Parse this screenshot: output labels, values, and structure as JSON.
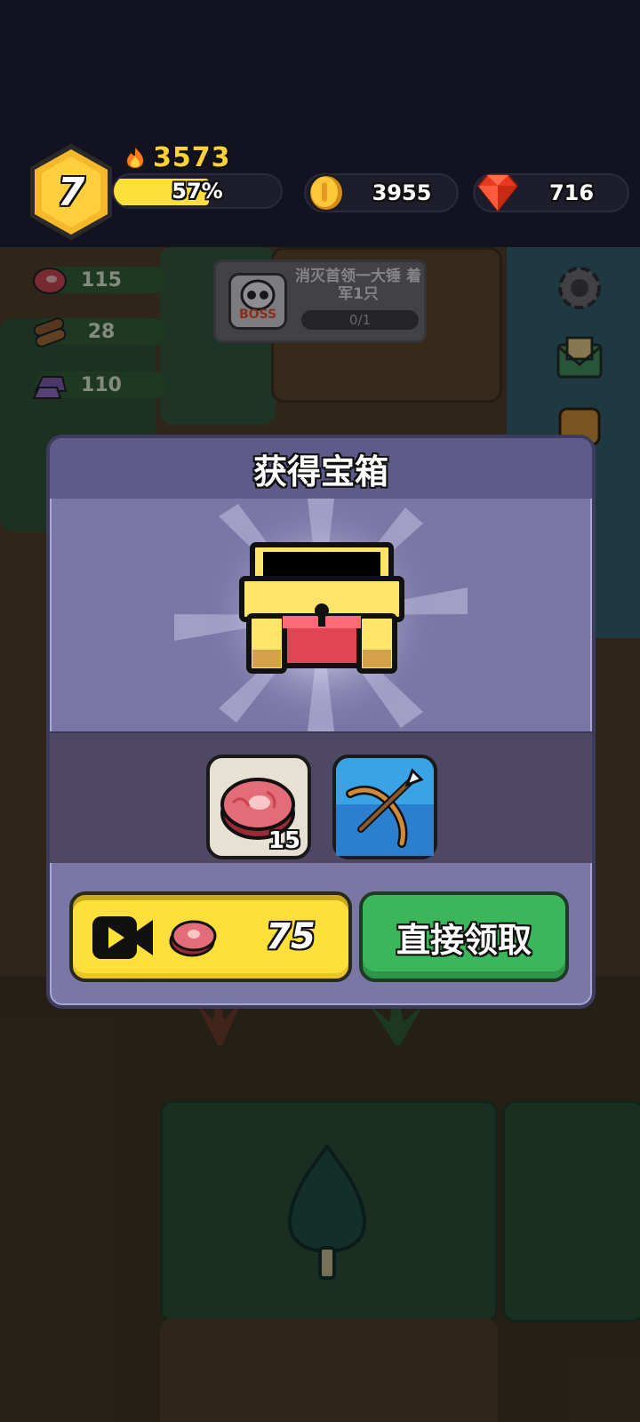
{
  "hud": {
    "level": "7",
    "power": "3573",
    "exp_percent_label": "57%",
    "exp_fraction": 0.57,
    "coins": "3955",
    "gems": "716"
  },
  "side_resources": [
    {
      "name": "meat",
      "value": "115"
    },
    {
      "name": "wood",
      "value": "28"
    },
    {
      "name": "ore",
      "value": "110"
    }
  ],
  "boss_task": {
    "badge": "BOSS",
    "text": "消灭首领一大锤 着军1只",
    "progress": "0/1"
  },
  "modal": {
    "title": "获得宝箱",
    "rewards": [
      {
        "icon": "meat-icon",
        "count": "15"
      },
      {
        "icon": "crossbow-icon",
        "count": ""
      }
    ],
    "ad_button": {
      "icons": [
        "video-camera-icon",
        "meat-icon"
      ],
      "amount": "75"
    },
    "claim_button": {
      "label": "直接领取"
    }
  },
  "colors": {
    "accent_yellow": "#ffe03a",
    "claim_green": "#3cb65a",
    "modal_purple": "#7a77a6",
    "header_purple": "#5e5a8a"
  }
}
